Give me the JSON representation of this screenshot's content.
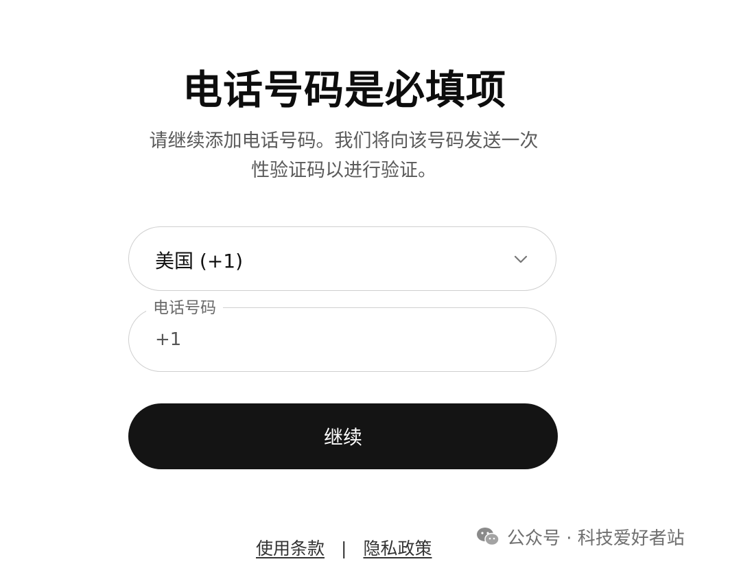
{
  "header": {
    "title": "电话号码是必填项",
    "subtitle_line1": "请继续添加电话号码。我们将向该号码发送一次",
    "subtitle_line2": "性验证码以进行验证。"
  },
  "country_select": {
    "value": "美国 (+1)",
    "icon": "chevron-down-icon"
  },
  "phone_field": {
    "label": "电话号码",
    "value": "+1"
  },
  "continue_button": {
    "label": "继续"
  },
  "footer": {
    "terms_label": "使用条款",
    "separator": "|",
    "privacy_label": "隐私政策"
  },
  "watermark": {
    "text": "公众号 · 科技爱好者站",
    "icon": "wechat-icon"
  },
  "colors": {
    "primary_button": "#141414",
    "border": "#cfcfcf",
    "text": "#111111",
    "muted_text": "#5a5a5a"
  }
}
